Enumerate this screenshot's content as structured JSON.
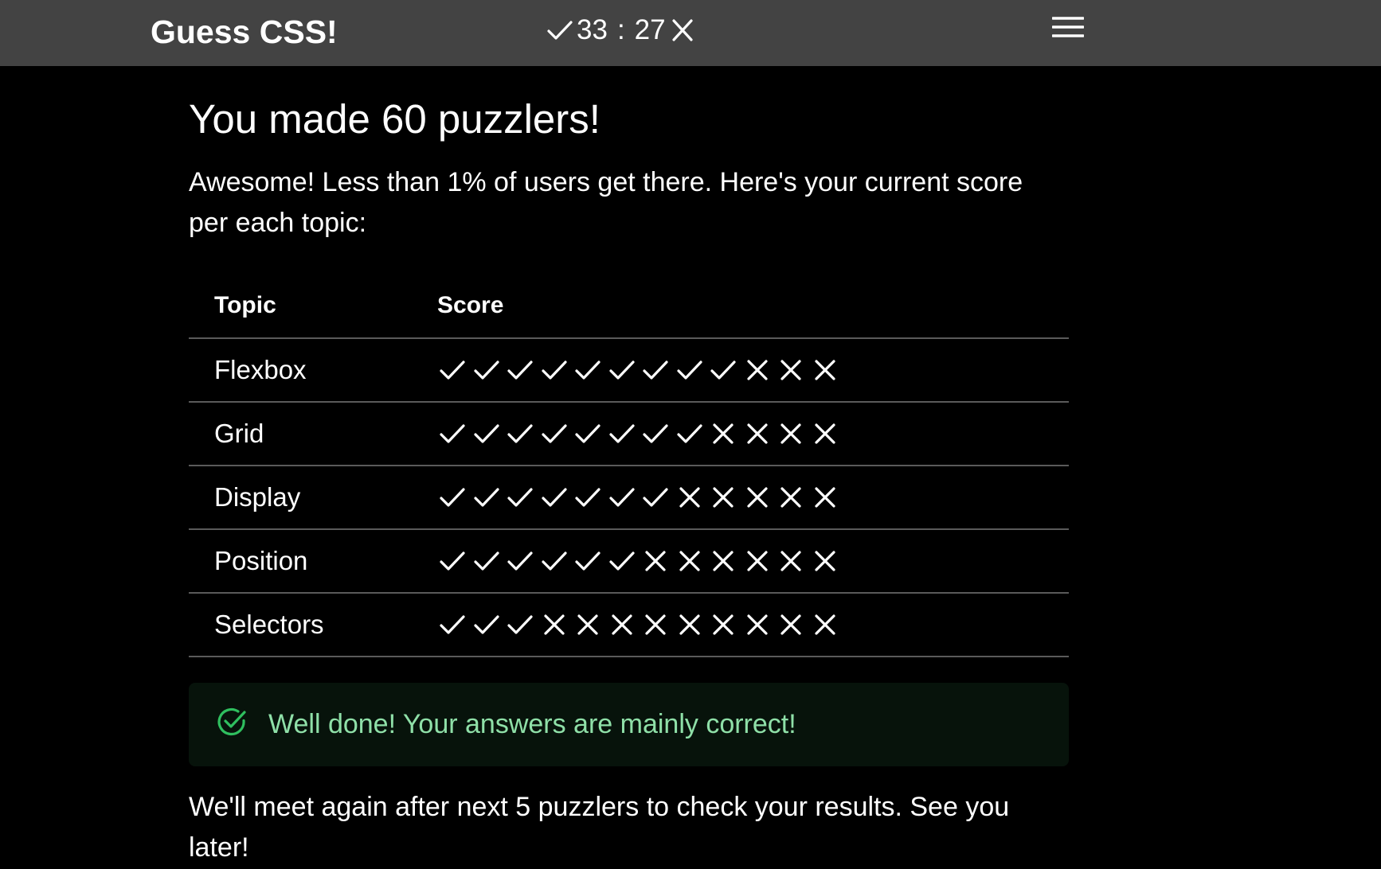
{
  "header": {
    "brand": "Guess CSS!",
    "correct_count": "33",
    "separator": ":",
    "wrong_count": "27",
    "icons": {
      "correct": "check-icon",
      "wrong": "cross-icon",
      "menu": "hamburger-menu-icon"
    }
  },
  "main": {
    "title": "You made 60 puzzlers!",
    "intro": "Awesome! Less than 1% of users get there. Here's your current score per each topic:",
    "table": {
      "headers": [
        "Topic",
        "Score"
      ],
      "rows": [
        {
          "topic": "Flexbox",
          "correct": 9,
          "total": 12
        },
        {
          "topic": "Grid",
          "correct": 8,
          "total": 12
        },
        {
          "topic": "Display",
          "correct": 7,
          "total": 12
        },
        {
          "topic": "Position",
          "correct": 6,
          "total": 12
        },
        {
          "topic": "Selectors",
          "correct": 3,
          "total": 12
        }
      ]
    },
    "alert": {
      "icon": "check-circle-icon",
      "text": "Well done! Your answers are mainly correct!"
    },
    "outro": "We'll meet again after next 5 puzzlers to check your results. See you later!"
  },
  "colors": {
    "topbar": "#434343",
    "background": "#000000",
    "text": "#ffffff",
    "success_text": "#8fe0a8",
    "success_icon": "#2fbf5f",
    "success_bg": "#07130b",
    "divider": "#5a5a5a"
  }
}
